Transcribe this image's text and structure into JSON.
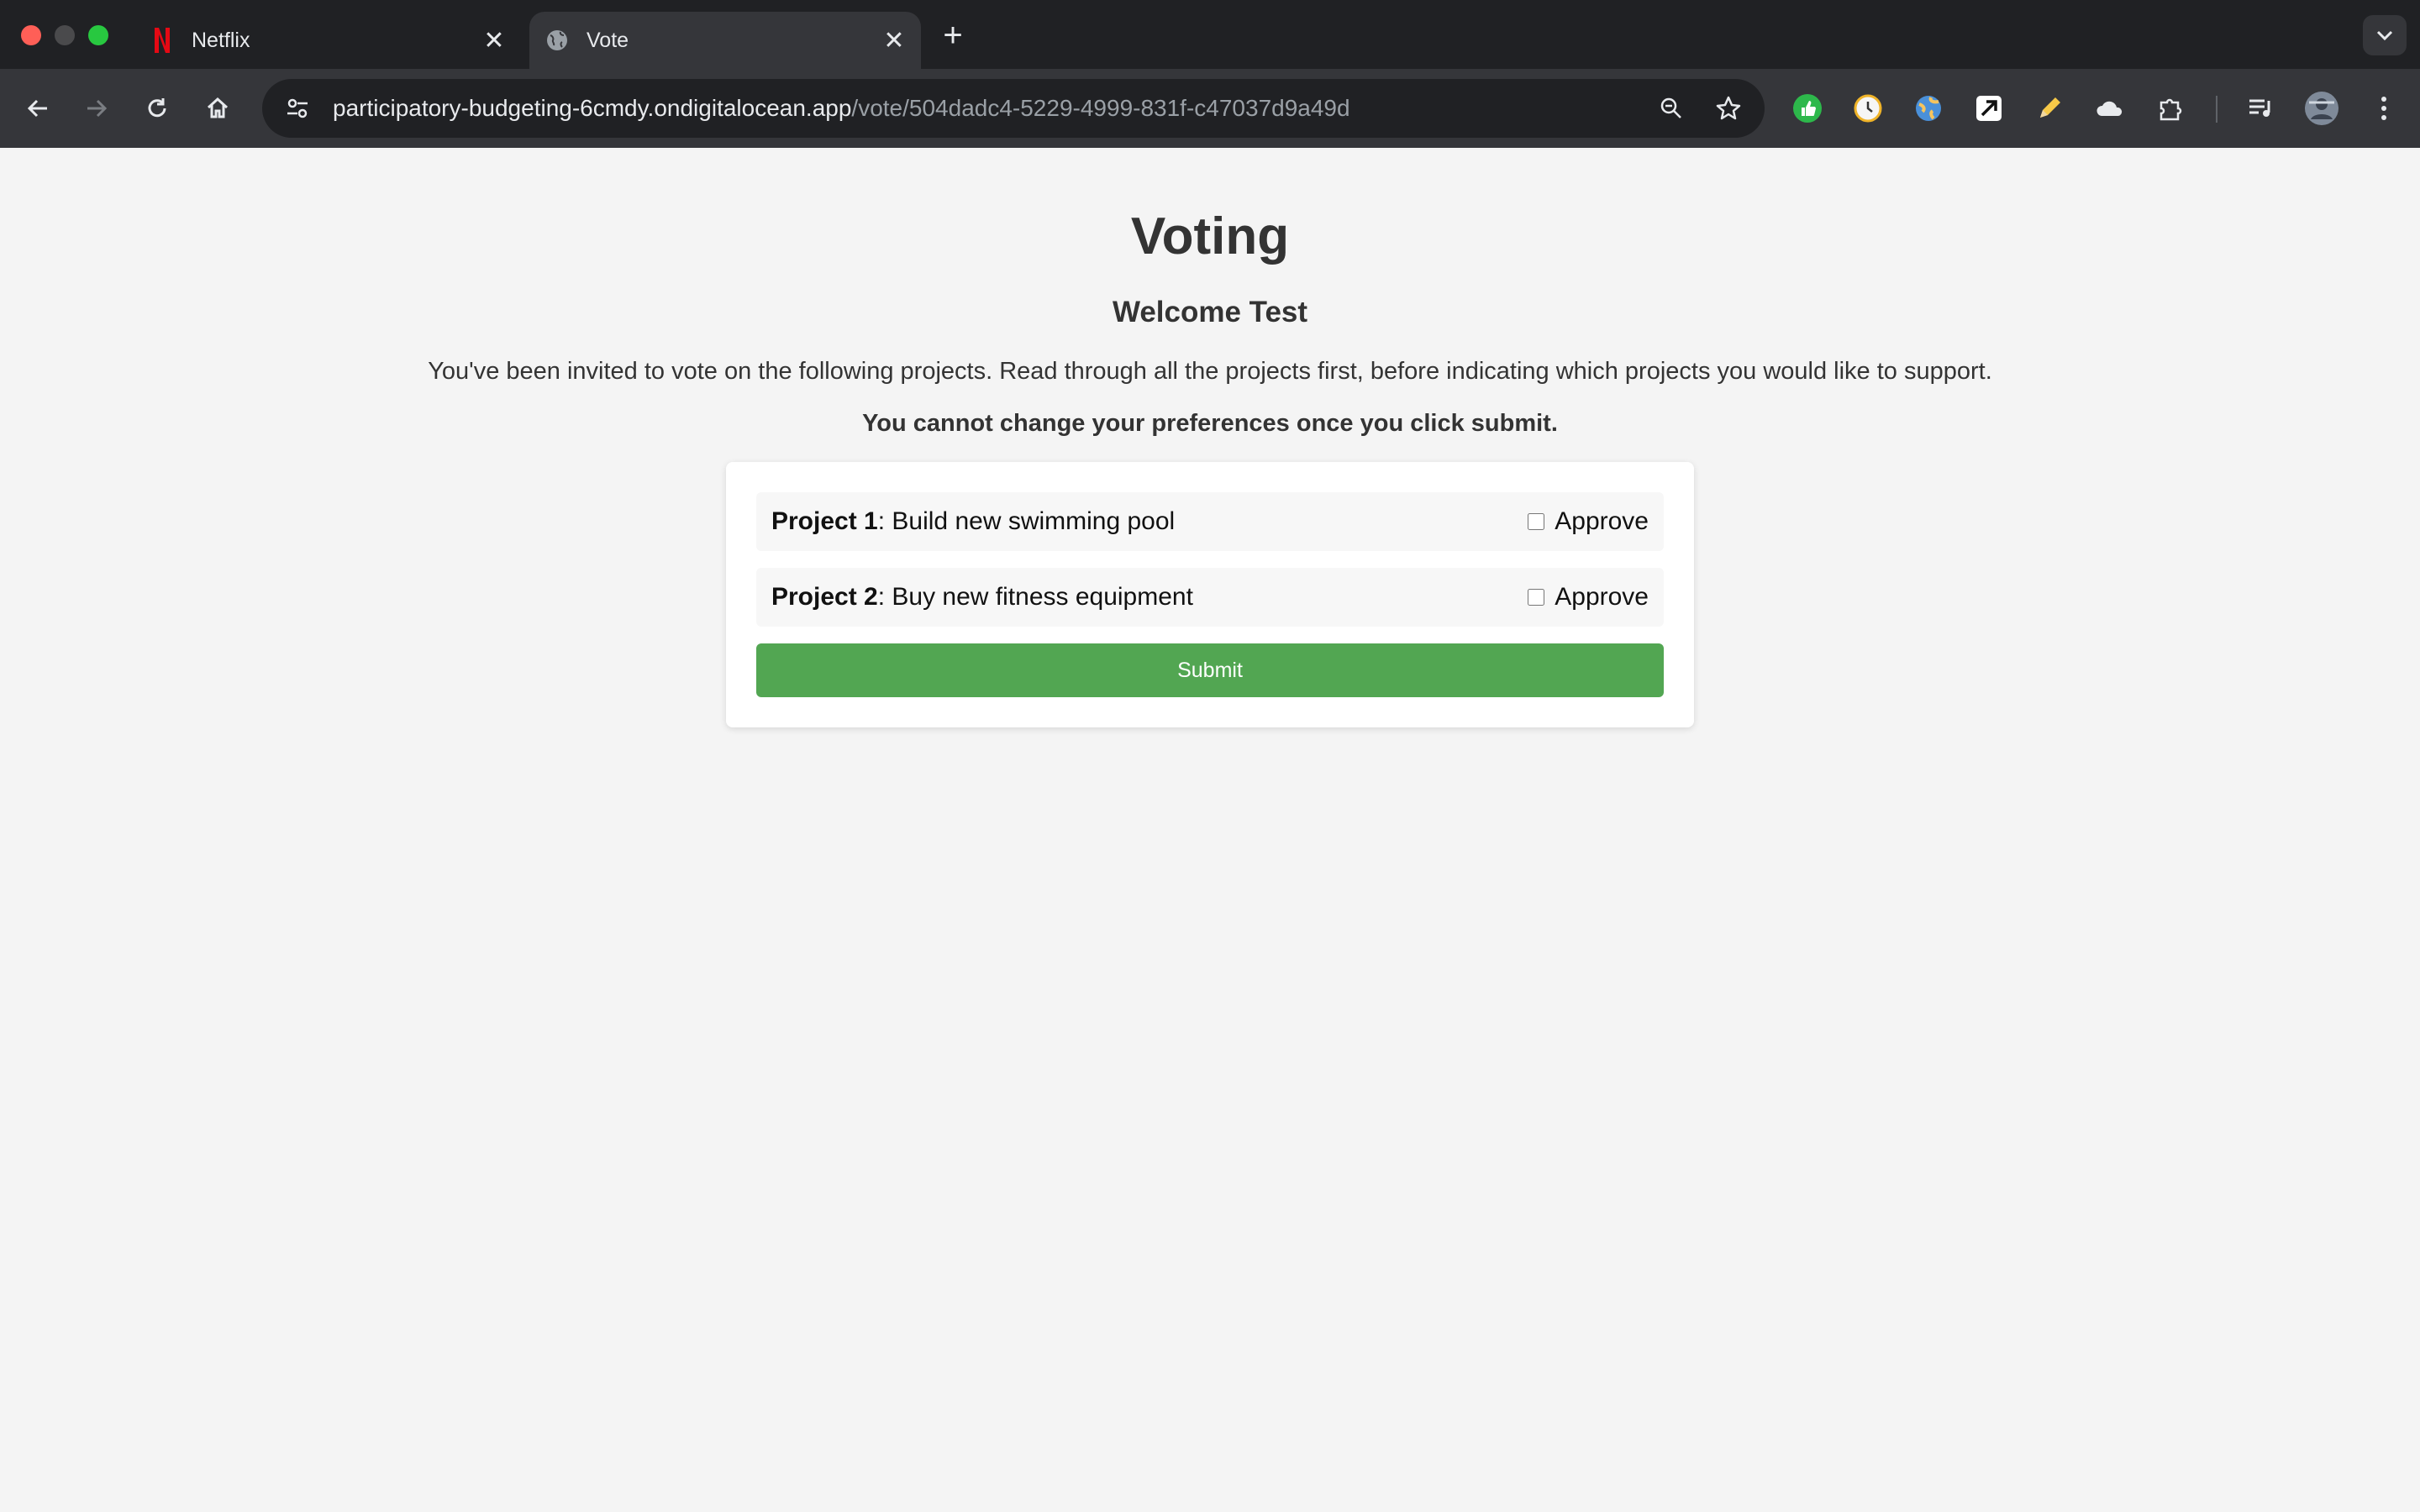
{
  "browser": {
    "tabs": [
      {
        "title": "Netflix",
        "favicon": "netflix-n-icon",
        "active": false
      },
      {
        "title": "Vote",
        "favicon": "globe-icon",
        "active": true
      }
    ],
    "address": {
      "host": "participatory-budgeting-6cmdy.ondigitalocean.app",
      "path": "/vote/504dadc4-5229-4999-831f-c47037d9a49d"
    },
    "extensions": [
      "green-thumbs-icon",
      "clock-icon",
      "globe-ext-icon",
      "square-arrow-icon",
      "pencil-icon",
      "cloud-icon",
      "puzzle-icon"
    ]
  },
  "page": {
    "title": "Voting",
    "welcome": "Welcome Test",
    "intro": "You've been invited to vote on the following projects. Read through all the projects first, before indicating which projects you would like to support.",
    "warning": "You cannot change your preferences once you click submit.",
    "projects": [
      {
        "label": "Project 1",
        "description": ": Build new swimming pool",
        "approve_label": "Approve",
        "checked": false
      },
      {
        "label": "Project 2",
        "description": ": Buy new fitness equipment",
        "approve_label": "Approve",
        "checked": false
      }
    ],
    "submit_label": "Submit"
  },
  "colors": {
    "submit": "#52a652",
    "page_bg": "#f4f4f4",
    "chrome_dark": "#202124",
    "chrome_toolbar": "#35363a"
  }
}
